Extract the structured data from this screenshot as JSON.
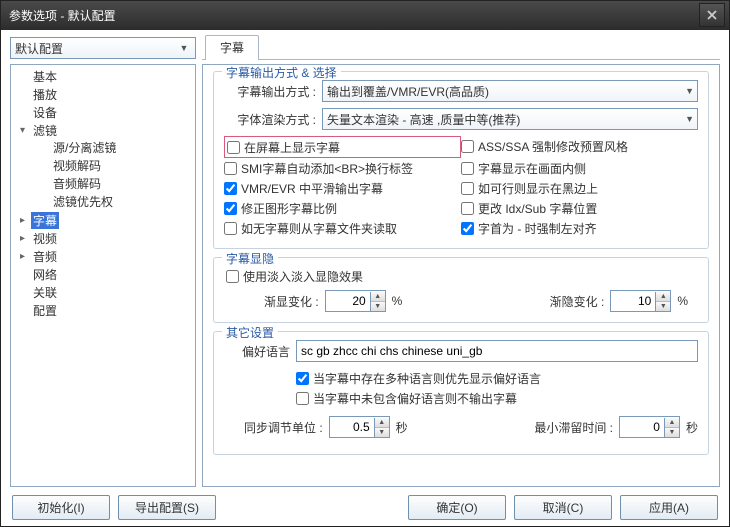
{
  "window": {
    "title": "参数选项 - 默认配置"
  },
  "profileCombo": {
    "value": "默认配置"
  },
  "tab": {
    "label": "字幕"
  },
  "tree": [
    {
      "label": "基本"
    },
    {
      "label": "播放"
    },
    {
      "label": "设备"
    },
    {
      "label": "滤镜",
      "expanded": true,
      "children": [
        {
          "label": "源/分离滤镜"
        },
        {
          "label": "视频解码"
        },
        {
          "label": "音频解码"
        },
        {
          "label": "滤镜优先权"
        }
      ]
    },
    {
      "label": "字幕",
      "selected": true,
      "hasChildren": true
    },
    {
      "label": "视频",
      "hasChildren": true
    },
    {
      "label": "音频",
      "hasChildren": true
    },
    {
      "label": "网络"
    },
    {
      "label": "关联"
    },
    {
      "label": "配置"
    }
  ],
  "groups": {
    "output": {
      "legend": "字幕输出方式 & 选择",
      "outputLabel": "字幕输出方式 :",
      "outputValue": "输出到覆盖/VMR/EVR(高品质)",
      "renderLabel": "字体渲染方式 :",
      "renderValue": "矢量文本渲染 - 高速 ,质量中等(推荐)",
      "checks": [
        {
          "label": "在屏幕上显示字幕",
          "checked": false,
          "highlight": true,
          "name": "check-show-on-screen"
        },
        {
          "label": "ASS/SSA 强制修改预置风格",
          "checked": false,
          "name": "check-ass-force-style"
        },
        {
          "label": "SMI字幕自动添加<BR>换行标签",
          "checked": false,
          "name": "check-smi-br"
        },
        {
          "label": "字幕显示在画面内侧",
          "checked": false,
          "name": "check-inside-video"
        },
        {
          "label": "VMR/EVR 中平滑输出字幕",
          "checked": true,
          "name": "check-vmr-smooth"
        },
        {
          "label": "如可行则显示在黑边上",
          "checked": false,
          "name": "check-black-border"
        },
        {
          "label": "修正图形字幕比例",
          "checked": true,
          "name": "check-fix-graphic-ratio"
        },
        {
          "label": "更改 Idx/Sub 字幕位置",
          "checked": false,
          "name": "check-idxsub-pos"
        },
        {
          "label": "如无字幕则从字幕文件夹读取",
          "checked": false,
          "name": "check-fallback-folder"
        },
        {
          "label": "字首为 - 时强制左对齐",
          "checked": true,
          "name": "check-dash-left-align"
        }
      ]
    },
    "fade": {
      "legend": "字幕显隐",
      "enable": "使用淡入淡入显隐效果",
      "inLabel": "渐显变化 :",
      "inValue": "20",
      "outLabel": "渐隐变化 :",
      "outValue": "10",
      "unit": "%"
    },
    "other": {
      "legend": "其它设置",
      "langLabel": "偏好语言",
      "langValue": "sc gb zhcc chi chs chinese uni_gb",
      "multiLang": "当字幕中存在多种语言则优先显示偏好语言",
      "noLang": "当字幕中未包含偏好语言则不输出字幕",
      "syncLabel": "同步调节单位 :",
      "syncValue": "0.5",
      "minStayLabel": "最小滞留时间 :",
      "minStayValue": "0",
      "secUnit": "秒"
    }
  },
  "footer": {
    "init": "初始化(I)",
    "export": "导出配置(S)",
    "ok": "确定(O)",
    "cancel": "取消(C)",
    "apply": "应用(A)"
  }
}
